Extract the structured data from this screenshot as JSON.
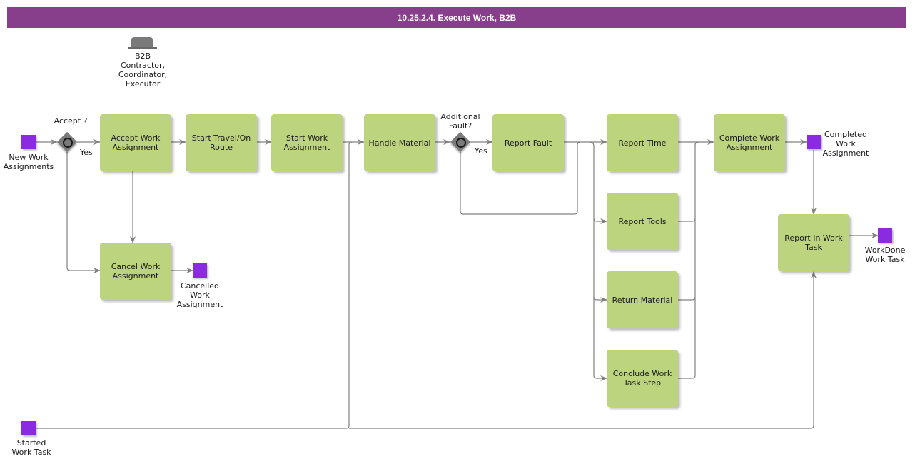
{
  "title": "10.25.2.4. Execute Work, B2B",
  "role": {
    "icon": "role-hat-icon",
    "label": "B2B\nContractor,\nCoordinator,\nExecutor"
  },
  "colors": {
    "title_bar": "#873e8b",
    "task": "#bdd47e",
    "event": "#8a2be2",
    "gateway": "#7a7a7a",
    "edge": "#808080"
  },
  "events": {
    "new_work": "New Work\nAssignments",
    "cancelled": "Cancelled\nWork\nAssignment",
    "completed": "Completed\nWork\nAssignment",
    "workdone": "WorkDone\nWork Task",
    "started": "Started\nWork Task"
  },
  "gateways": {
    "accept": {
      "question": "Accept ?",
      "yes": "Yes"
    },
    "fault": {
      "question": "Additional\nFault?",
      "yes": "Yes"
    }
  },
  "tasks": {
    "accept": "Accept Work Assignment",
    "travel": "Start Travel/On Route",
    "start_work": "Start Work Assignment",
    "handle_material": "Handle Material",
    "report_fault": "Report Fault",
    "report_time": "Report Time",
    "report_tools": "Report Tools",
    "return_material": "Return Material",
    "conclude": "Conclude Work Task Step",
    "complete": "Complete Work Assignment",
    "cancel": "Cancel Work Assignment",
    "report_in": "Report In Work Task"
  }
}
